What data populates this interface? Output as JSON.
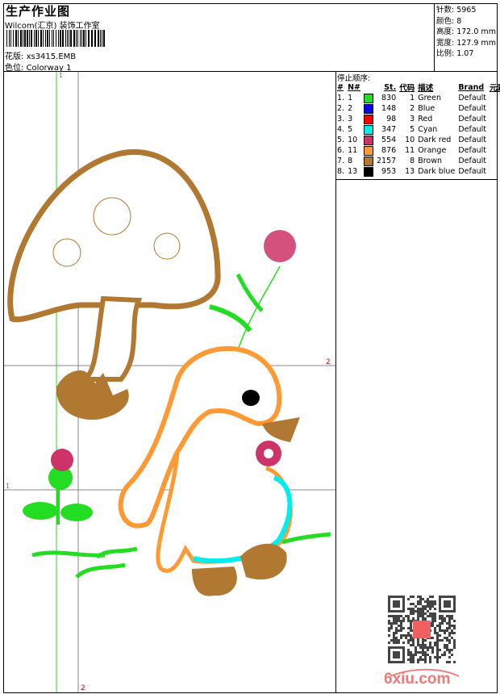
{
  "header": {
    "title": "生产作业图",
    "company": "Wilcom(汇京) 装饰工作室",
    "design_label": "花版:",
    "design_value": "xs3415.EMB",
    "colorway_label": "色位:",
    "colorway_value": "Colorway 1"
  },
  "info": {
    "stitches": "针数: 5965",
    "colors": "颜色: 8",
    "height": "高度: 172.0 mm",
    "width": "宽度: 127.9 mm",
    "scale": "比例: 1.07"
  },
  "sequence": {
    "title": "停止顺序:",
    "headers": [
      "#",
      "N#",
      "",
      "St.",
      "代码",
      "描述",
      "Brand",
      "元素"
    ],
    "rows": [
      {
        "idx": "1.",
        "n": "1",
        "color": "#22dd22",
        "st": "830",
        "code": "1",
        "desc": "Green",
        "brand": "Default"
      },
      {
        "idx": "2.",
        "n": "2",
        "color": "#0000ee",
        "st": "148",
        "code": "2",
        "desc": "Blue",
        "brand": "Default"
      },
      {
        "idx": "3.",
        "n": "3",
        "color": "#ff0000",
        "st": "98",
        "code": "3",
        "desc": "Red",
        "brand": "Default"
      },
      {
        "idx": "4.",
        "n": "5",
        "color": "#00eeee",
        "st": "347",
        "code": "5",
        "desc": "Cyan",
        "brand": "Default"
      },
      {
        "idx": "5.",
        "n": "10",
        "color": "#cc3366",
        "st": "554",
        "code": "10",
        "desc": "Dark red",
        "brand": "Default"
      },
      {
        "idx": "6.",
        "n": "11",
        "color": "#ff9933",
        "st": "876",
        "code": "11",
        "desc": "Orange",
        "brand": "Default"
      },
      {
        "idx": "7.",
        "n": "8",
        "color": "#b07830",
        "st": "2157",
        "code": "8",
        "desc": "Brown",
        "brand": "Default"
      },
      {
        "idx": "8.",
        "n": "13",
        "color": "#000000",
        "st": "953",
        "code": "13",
        "desc": "Dark blue",
        "brand": "Default"
      }
    ]
  },
  "guides": {
    "v1": "1",
    "h2": "2",
    "h1": "1",
    "v2": "2"
  },
  "watermark": {
    "logo_text": "6xiu.com"
  }
}
